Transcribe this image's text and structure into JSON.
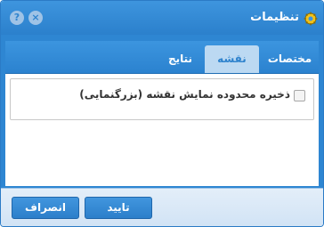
{
  "dialog": {
    "title": "تنظیمات",
    "help_button": "?",
    "close_button": "×"
  },
  "tabs": [
    {
      "label": "مختصات"
    },
    {
      "label": "نقشه"
    },
    {
      "label": "نتایج"
    }
  ],
  "map_tab": {
    "save_extent_label": "ذخیره محدوده نمایش نقشه (بزرگنمایی)",
    "save_extent_checked": false
  },
  "footer": {
    "ok_label": "تایید",
    "cancel_label": "انصراف"
  },
  "colors": {
    "accent": "#2e86d2",
    "active_tab": "#bcd9f2",
    "footer_bg": "#dbe9f7"
  }
}
